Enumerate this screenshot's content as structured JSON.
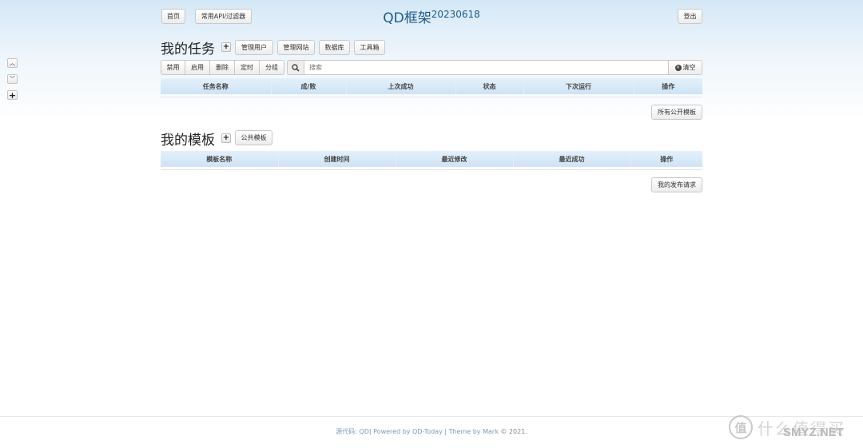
{
  "header": {
    "home_label": "首页",
    "api_label": "常用API/过滤器",
    "title": "QD框架",
    "version": "20230618",
    "logout_label": "登出"
  },
  "side": {
    "up_icon": "chevron-up-icon",
    "down_icon": "chevron-down-icon",
    "add_icon": "plus-icon"
  },
  "tasks": {
    "title": "我的任务",
    "add_label": "+",
    "buttons": [
      "管理用户",
      "管理网站",
      "数据库",
      "工具箱"
    ],
    "toolbar": [
      "禁用",
      "启用",
      "删除",
      "定时",
      "分组"
    ],
    "search_placeholder": "搜索",
    "clear_label": "清空",
    "columns": [
      "任务名称",
      "成/败",
      "上次成功",
      "状态",
      "下次运行",
      "操作"
    ],
    "public_templates_label": "所有公开模板"
  },
  "templates": {
    "title": "我的模板",
    "add_label": "+",
    "public_label": "公共模板",
    "columns": [
      "模板名称",
      "创建时间",
      "最近修改",
      "最近成功",
      "操作"
    ],
    "publish_requests_label": "我的发布请求"
  },
  "footer": {
    "source_label": "源代码",
    "source_link": "QD",
    "sep1": "|",
    "powered_by": "Powered by QD-Today",
    "sep2": "|",
    "theme_by": "Theme by",
    "author": "Mark",
    "copyright": "© 2021."
  },
  "watermark": {
    "logo_char": "值",
    "cn_text": "什么值得买",
    "en_text": "SMYZ.NET"
  }
}
